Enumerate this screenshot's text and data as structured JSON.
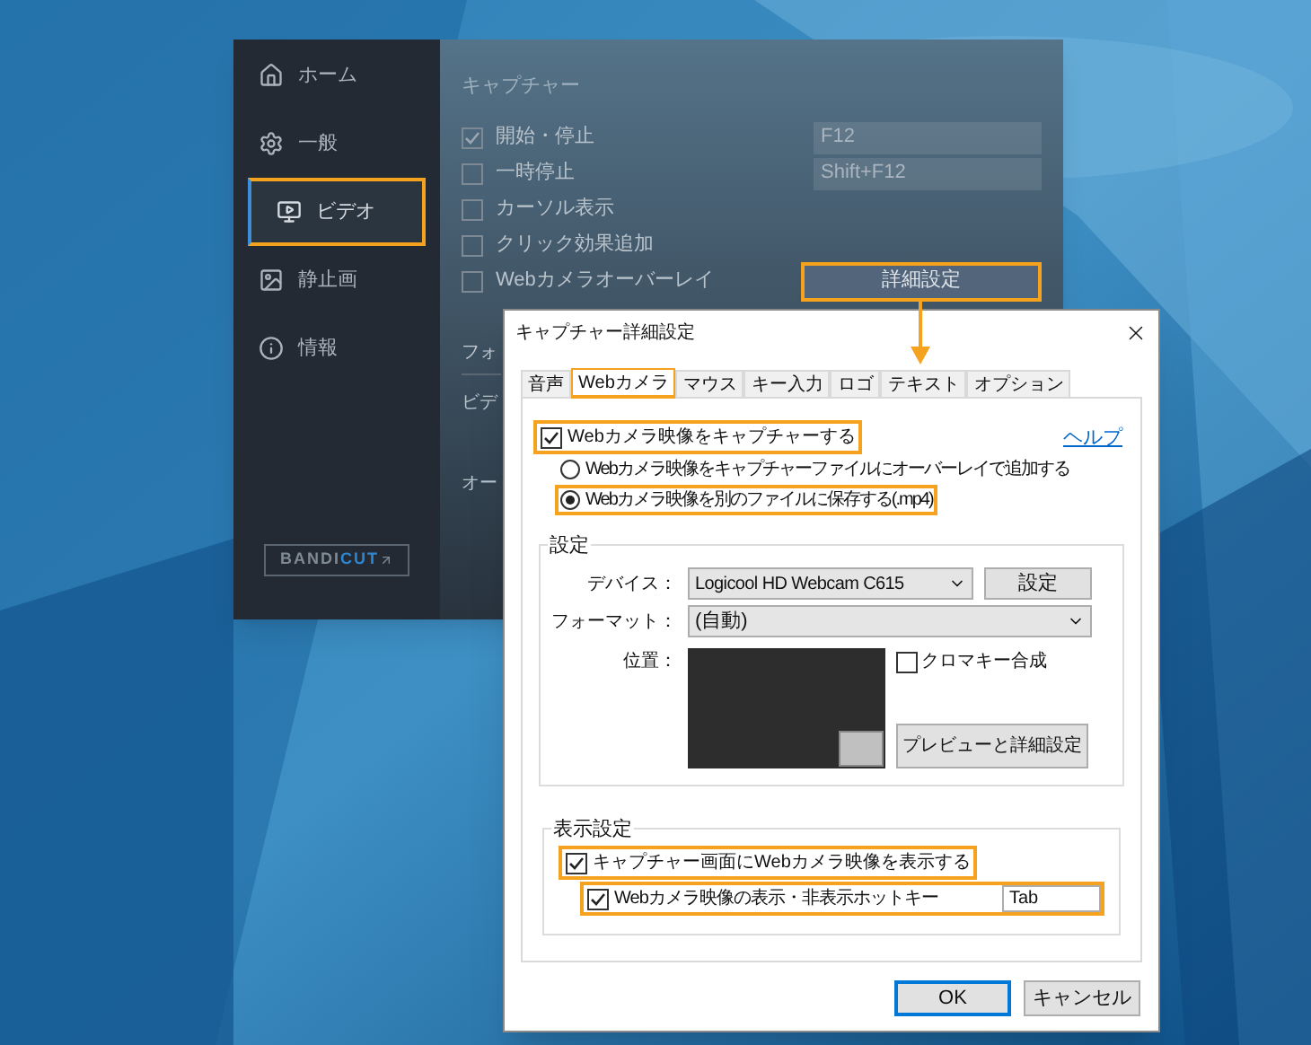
{
  "main_window": {
    "sidebar": [
      {
        "label": "ホーム",
        "selected": false,
        "highlighted": false
      },
      {
        "label": "一般",
        "selected": false,
        "highlighted": false
      },
      {
        "label": "ビデオ",
        "selected": true,
        "highlighted": true
      },
      {
        "label": "静止画",
        "selected": false,
        "highlighted": false
      },
      {
        "label": "情報",
        "selected": false,
        "highlighted": false
      }
    ],
    "logo_button": {
      "text": "BANDI",
      "accent": "CUT"
    },
    "capture": {
      "heading": "キャプチャー",
      "options": [
        {
          "label": "開始・停止",
          "checked": true,
          "hotkey": "F12"
        },
        {
          "label": "一時停止",
          "checked": false,
          "hotkey": "Shift+F12"
        },
        {
          "label": "カーソル表示",
          "checked": false
        },
        {
          "label": "クリック効果追加",
          "checked": false
        },
        {
          "label": "Webカメラオーバーレイ",
          "checked": false
        }
      ]
    },
    "advanced_button": {
      "label": "詳細設定",
      "highlighted": true
    },
    "format": {
      "heading": "フォ",
      "rows": [
        "ビデ",
        "オー"
      ]
    }
  },
  "dialog": {
    "title": "キャプチャー詳細設定",
    "tabs": [
      {
        "label": "音声",
        "selected": false,
        "highlighted": false
      },
      {
        "label": "Webカメラ",
        "selected": true,
        "highlighted": true
      },
      {
        "label": "マウス",
        "selected": false,
        "highlighted": false
      },
      {
        "label": "キー入力",
        "selected": false,
        "highlighted": false
      },
      {
        "label": "ロゴ",
        "selected": false,
        "highlighted": false
      },
      {
        "label": "テキスト",
        "selected": false,
        "highlighted": false
      },
      {
        "label": "オプション",
        "selected": false,
        "highlighted": false
      }
    ],
    "capture_webcam": {
      "label": "Webカメラ映像をキャプチャーする",
      "checked": true,
      "highlighted": true
    },
    "help_link": "ヘルプ",
    "modes": [
      {
        "label": "Webカメラ映像をキャプチャーファイルにオーバーレイで追加する",
        "selected": false,
        "highlighted": false
      },
      {
        "label": "Webカメラ映像を別のファイルに保存する(.mp4)",
        "selected": true,
        "highlighted": true
      }
    ],
    "settings": {
      "title": "設定",
      "device_label": "デバイス：",
      "device": "Logicool HD Webcam C615",
      "device_button": "設定",
      "format_label": "フォーマット：",
      "format": "(自動)",
      "position_label": "位置：",
      "chroma_key": {
        "label": "クロマキー合成",
        "checked": false
      },
      "preview_button": "プレビューと詳細設定"
    },
    "display": {
      "title": "表示設定",
      "show_webcam": {
        "label": "キャプチャー画面にWebカメラ映像を表示する",
        "checked": true,
        "highlighted": true
      },
      "hotkey_toggle": {
        "label": "Webカメラ映像の表示・非表示ホットキー",
        "checked": true,
        "highlighted": true,
        "value": "Tab"
      }
    },
    "buttons": [
      {
        "label": "OK",
        "default": true
      },
      {
        "label": "キャンセル",
        "default": false
      }
    ]
  }
}
